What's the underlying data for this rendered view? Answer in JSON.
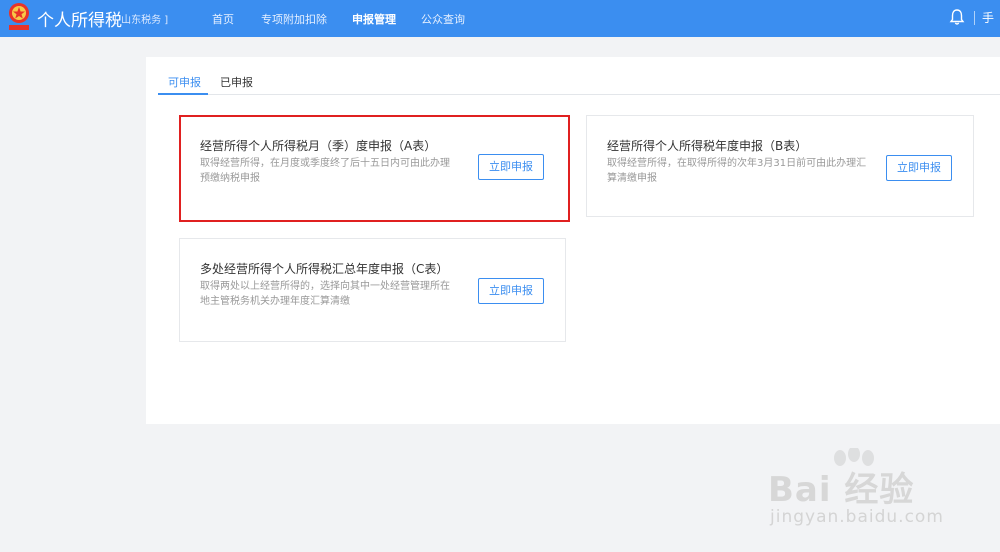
{
  "header": {
    "brand": "个人所得税",
    "region": "[ 山东税务 ]",
    "nav": [
      "首页",
      "专项附加扣除",
      "申报管理",
      "公众查询"
    ],
    "active_nav": "申报管理",
    "user_clip": "手"
  },
  "tabs": [
    "可申报",
    "已申报"
  ],
  "cards": [
    {
      "title": "经营所得个人所得税月（季）度申报（A表）",
      "desc_line1": "取得经营所得，在月度或季度终了后十五日内可由此办理",
      "desc_line2": "预缴纳税申报",
      "button": "立即申报"
    },
    {
      "title": "经营所得个人所得税年度申报（B表）",
      "desc_line1": "取得经营所得，在取得所得的次年3月31日前可由此办理汇",
      "desc_line2": "算清缴申报",
      "button": "立即申报"
    },
    {
      "title": "多处经营所得个人所得税汇总年度申报（C表）",
      "desc_line1": "取得两处以上经营所得的，选择向其中一处经营管理所在",
      "desc_line2": "地主管税务机关办理年度汇算清缴",
      "button": "立即申报"
    }
  ],
  "watermark": {
    "brand": "Bai 经验",
    "url": "jingyan.baidu.com"
  },
  "colors": {
    "header_bg": "#3b8ef0",
    "accent": "#3b8ef0",
    "highlight_border": "#e02020"
  }
}
